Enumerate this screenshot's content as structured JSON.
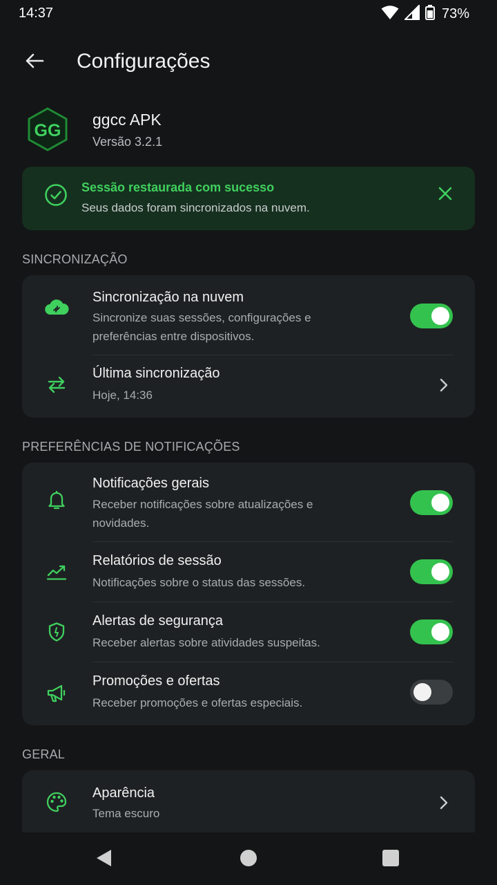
{
  "status_bar": {
    "time": "14:37",
    "battery": "73%"
  },
  "header": {
    "title": "Configurações"
  },
  "app": {
    "logo_text": "GG",
    "name": "ggcc APK",
    "version": "Versão 3.2.1"
  },
  "banner": {
    "title": "Sessão restaurada com sucesso",
    "message": "Seus dados foram sincronizados na nuvem."
  },
  "sections": {
    "sync": {
      "title": "SINCRONIZAÇÃO",
      "items": [
        {
          "title": "Sincronização na nuvem",
          "subtitle": "Sincronize suas sessões, configurações e preferências entre dispositivos.",
          "icon": "cloud-sync-icon",
          "toggle": true
        },
        {
          "title": "Última sincronização",
          "subtitle": "Hoje, 14:36",
          "icon": "sync-arrows-icon"
        }
      ]
    },
    "notifications": {
      "title": "PREFERÊNCIAS DE NOTIFICAÇÕES",
      "items": [
        {
          "title": "Notificações gerais",
          "subtitle": "Receber notificações sobre atualizações e novidades.",
          "icon": "bell-icon",
          "toggle": true
        },
        {
          "title": "Relatórios de sessão",
          "subtitle": "Notificações sobre o status das sessões.",
          "icon": "chart-line-icon",
          "toggle": true
        },
        {
          "title": "Alertas de segurança",
          "subtitle": "Receber alertas sobre atividades suspeitas.",
          "icon": "shield-icon",
          "toggle": true
        },
        {
          "title": "Promoções e ofertas",
          "subtitle": "Receber promoções e ofertas especiais.",
          "icon": "megaphone-icon",
          "toggle": false
        }
      ]
    },
    "general": {
      "title": "GERAL",
      "items": [
        {
          "title": "Aparência",
          "subtitle": "Tema escuro",
          "icon": "palette-icon"
        }
      ]
    }
  },
  "colors": {
    "accent": "#34c24f",
    "banner_bg": "#16301f",
    "card_bg": "#1e2123",
    "background": "#131516"
  }
}
